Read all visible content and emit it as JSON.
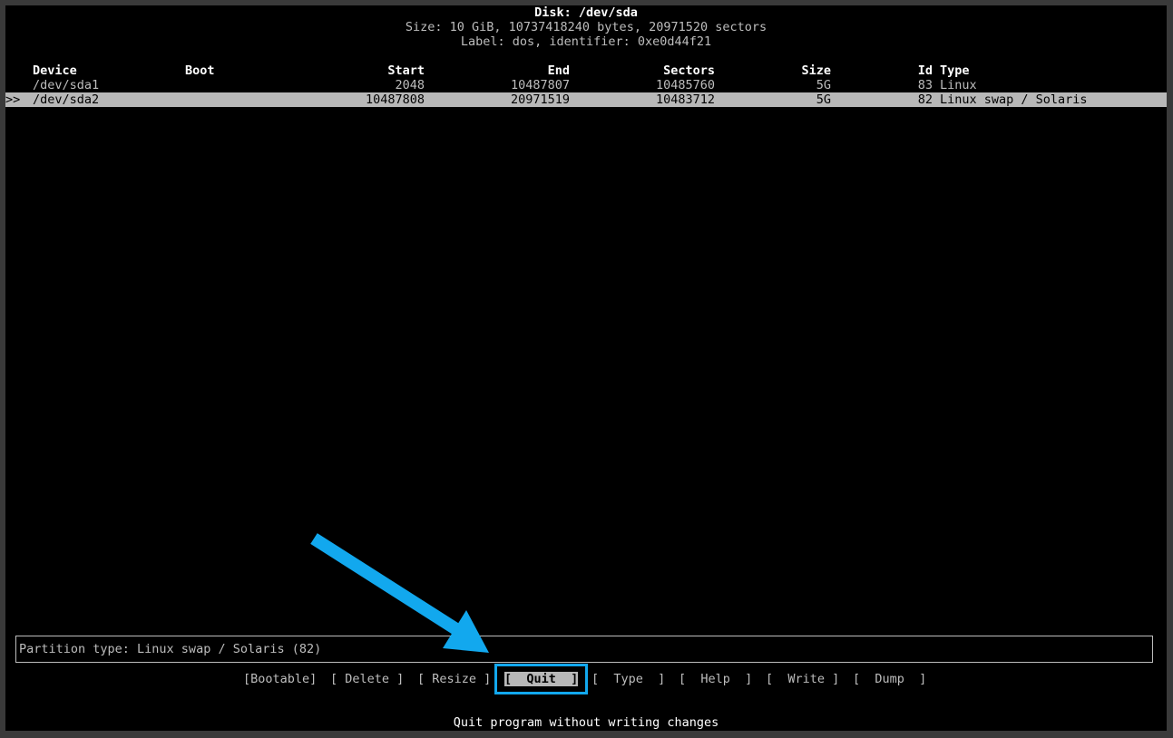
{
  "header": {
    "disk_line": "Disk: /dev/sda",
    "size_line": "Size: 10 GiB, 10737418240 bytes, 20971520 sectors",
    "label_line": "Label: dos, identifier: 0xe0d44f21"
  },
  "table": {
    "columns": {
      "device": "Device",
      "boot": "Boot",
      "start": "Start",
      "end": "End",
      "sectors": "Sectors",
      "size": "Size",
      "id": "Id",
      "type": "Type"
    },
    "rows": [
      {
        "marker": "",
        "device": "/dev/sda1",
        "boot": "",
        "start": "2048",
        "end": "10487807",
        "sectors": "10485760",
        "size": "5G",
        "id": "83",
        "type": "Linux"
      },
      {
        "marker": ">>",
        "device": "/dev/sda2",
        "boot": "",
        "start": "10487808",
        "end": "20971519",
        "sectors": "10483712",
        "size": "5G",
        "id": "82",
        "type": "Linux swap / Solaris"
      }
    ]
  },
  "info": {
    "partition_type": "Partition type: Linux swap / Solaris (82)"
  },
  "menu": {
    "bootable": "[Bootable]",
    "delete": "[ Delete ]",
    "resize": "[ Resize ]",
    "quit": "[  Quit  ]",
    "type": "[  Type  ]",
    "help": "[  Help  ]",
    "write": "[  Write ]",
    "dump": "[  Dump  ]"
  },
  "hint": "Quit program without writing changes",
  "colors": {
    "annotation_arrow": "#12a8ee",
    "selection_bg": "#b8b8b8"
  }
}
